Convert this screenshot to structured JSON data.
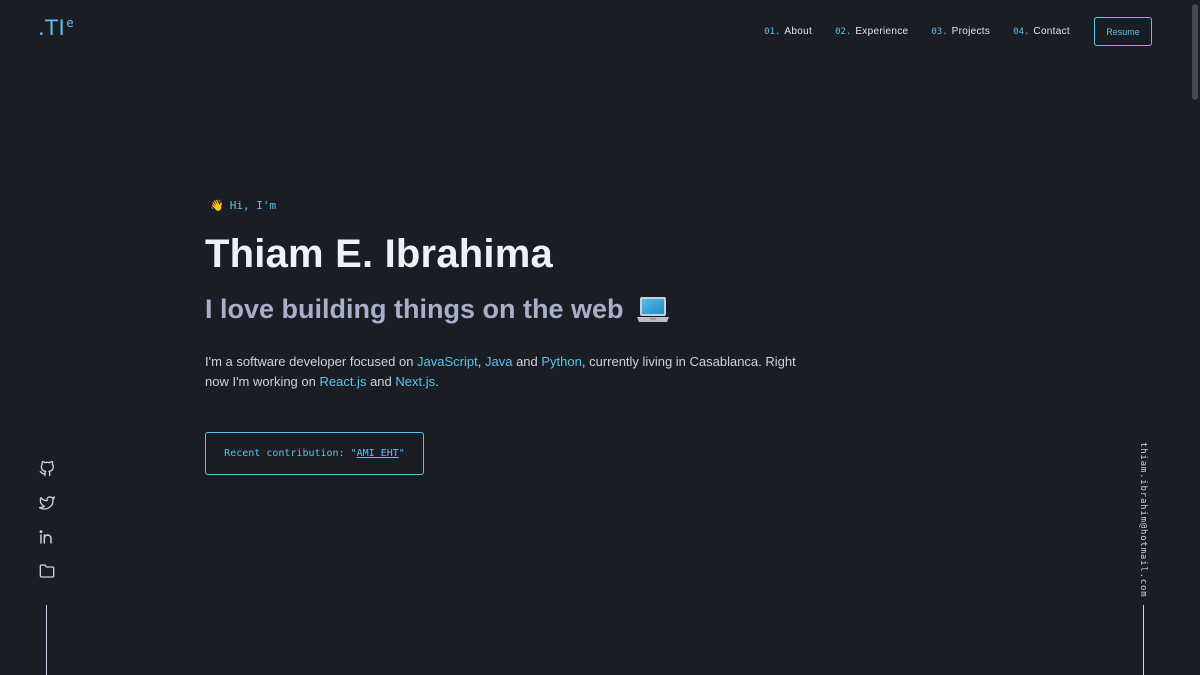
{
  "logo": {
    "text": ".TI",
    "sup": "e"
  },
  "nav": {
    "items": [
      {
        "num": "01.",
        "label": "About"
      },
      {
        "num": "02.",
        "label": "Experience"
      },
      {
        "num": "03.",
        "label": "Projects"
      },
      {
        "num": "04.",
        "label": "Contact"
      }
    ],
    "resume_label": "Resume"
  },
  "hero": {
    "greeting": "Hi, I'm",
    "greeting_emoji": "👋",
    "name": "Thiam E. Ibrahima",
    "tagline": "I love building things on the web",
    "description": {
      "p1": "I'm a software developer focused on ",
      "js": "JavaScript",
      "comma": ", ",
      "java": "Java",
      "and1": " and ",
      "python": "Python",
      "p2": ", currently living in Casablanca. Right now I'm working on ",
      "react": "React.js",
      "and2": " and ",
      "next": "Next.js",
      "period": "."
    },
    "contribution": {
      "prefix": "Recent contribution: \"",
      "link": "AMI EHT",
      "suffix": "\""
    }
  },
  "social": [
    "github-icon",
    "twitter-icon",
    "linkedin-icon",
    "folder-icon"
  ],
  "email": "thiam.ibrahim@hotmail.com",
  "colors": {
    "background": "#1b1d24",
    "accent": "#5bc3ea",
    "heading": "#eef1f7",
    "tagline": "#a9aec9"
  }
}
